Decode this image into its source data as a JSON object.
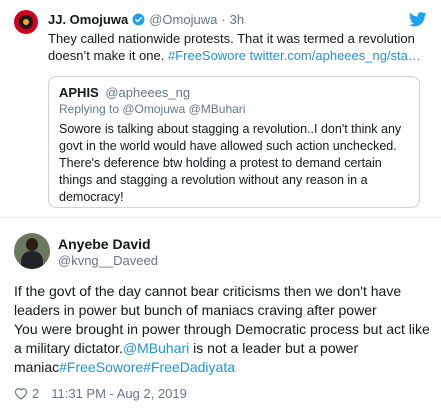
{
  "top_tweet": {
    "name": "JJ. Omojuwa",
    "handle": "@Omojuwa",
    "dot": "·",
    "time": "3h",
    "text_plain": "They called nationwide protests. That it was termed a revolution doesn’t make it one. ",
    "hashtag": "#FreeSowore",
    "link": "twitter.com/apheees_ng/sta…"
  },
  "quoted_tweet": {
    "name": "APHIS",
    "handle": "@apheees_ng",
    "replying_prefix": "Replying to ",
    "replying_to_1": "@Omojuwa",
    "replying_to_2": "@MBuhari",
    "text": "Sowore is talking about stagging a revolution..I don't think any govt in the world would have allowed such action unchecked. There's deference btw holding a protest to demand certain things and stagging a revolution without any reason in a democracy!"
  },
  "main_tweet": {
    "name": "Anyebe David",
    "handle": "@kvng__Daveed",
    "text_part1": "If the govt of the day cannot bear criticisms then we don't have leaders in power but bunch of maniacs craving after power\nYou were brought in power through Democratic process but act like a military dictator.",
    "mention": "@MBuhari",
    "text_part2": " is not a leader but a power maniac",
    "hashtags": "#FreeSowore#FreeDadiyata",
    "likes": "2",
    "timestamp": "11:31 PM - Aug 2, 2019"
  },
  "colors": {
    "link": "#1b95e0",
    "verified": "#1da1f2",
    "muted": "#657786"
  }
}
